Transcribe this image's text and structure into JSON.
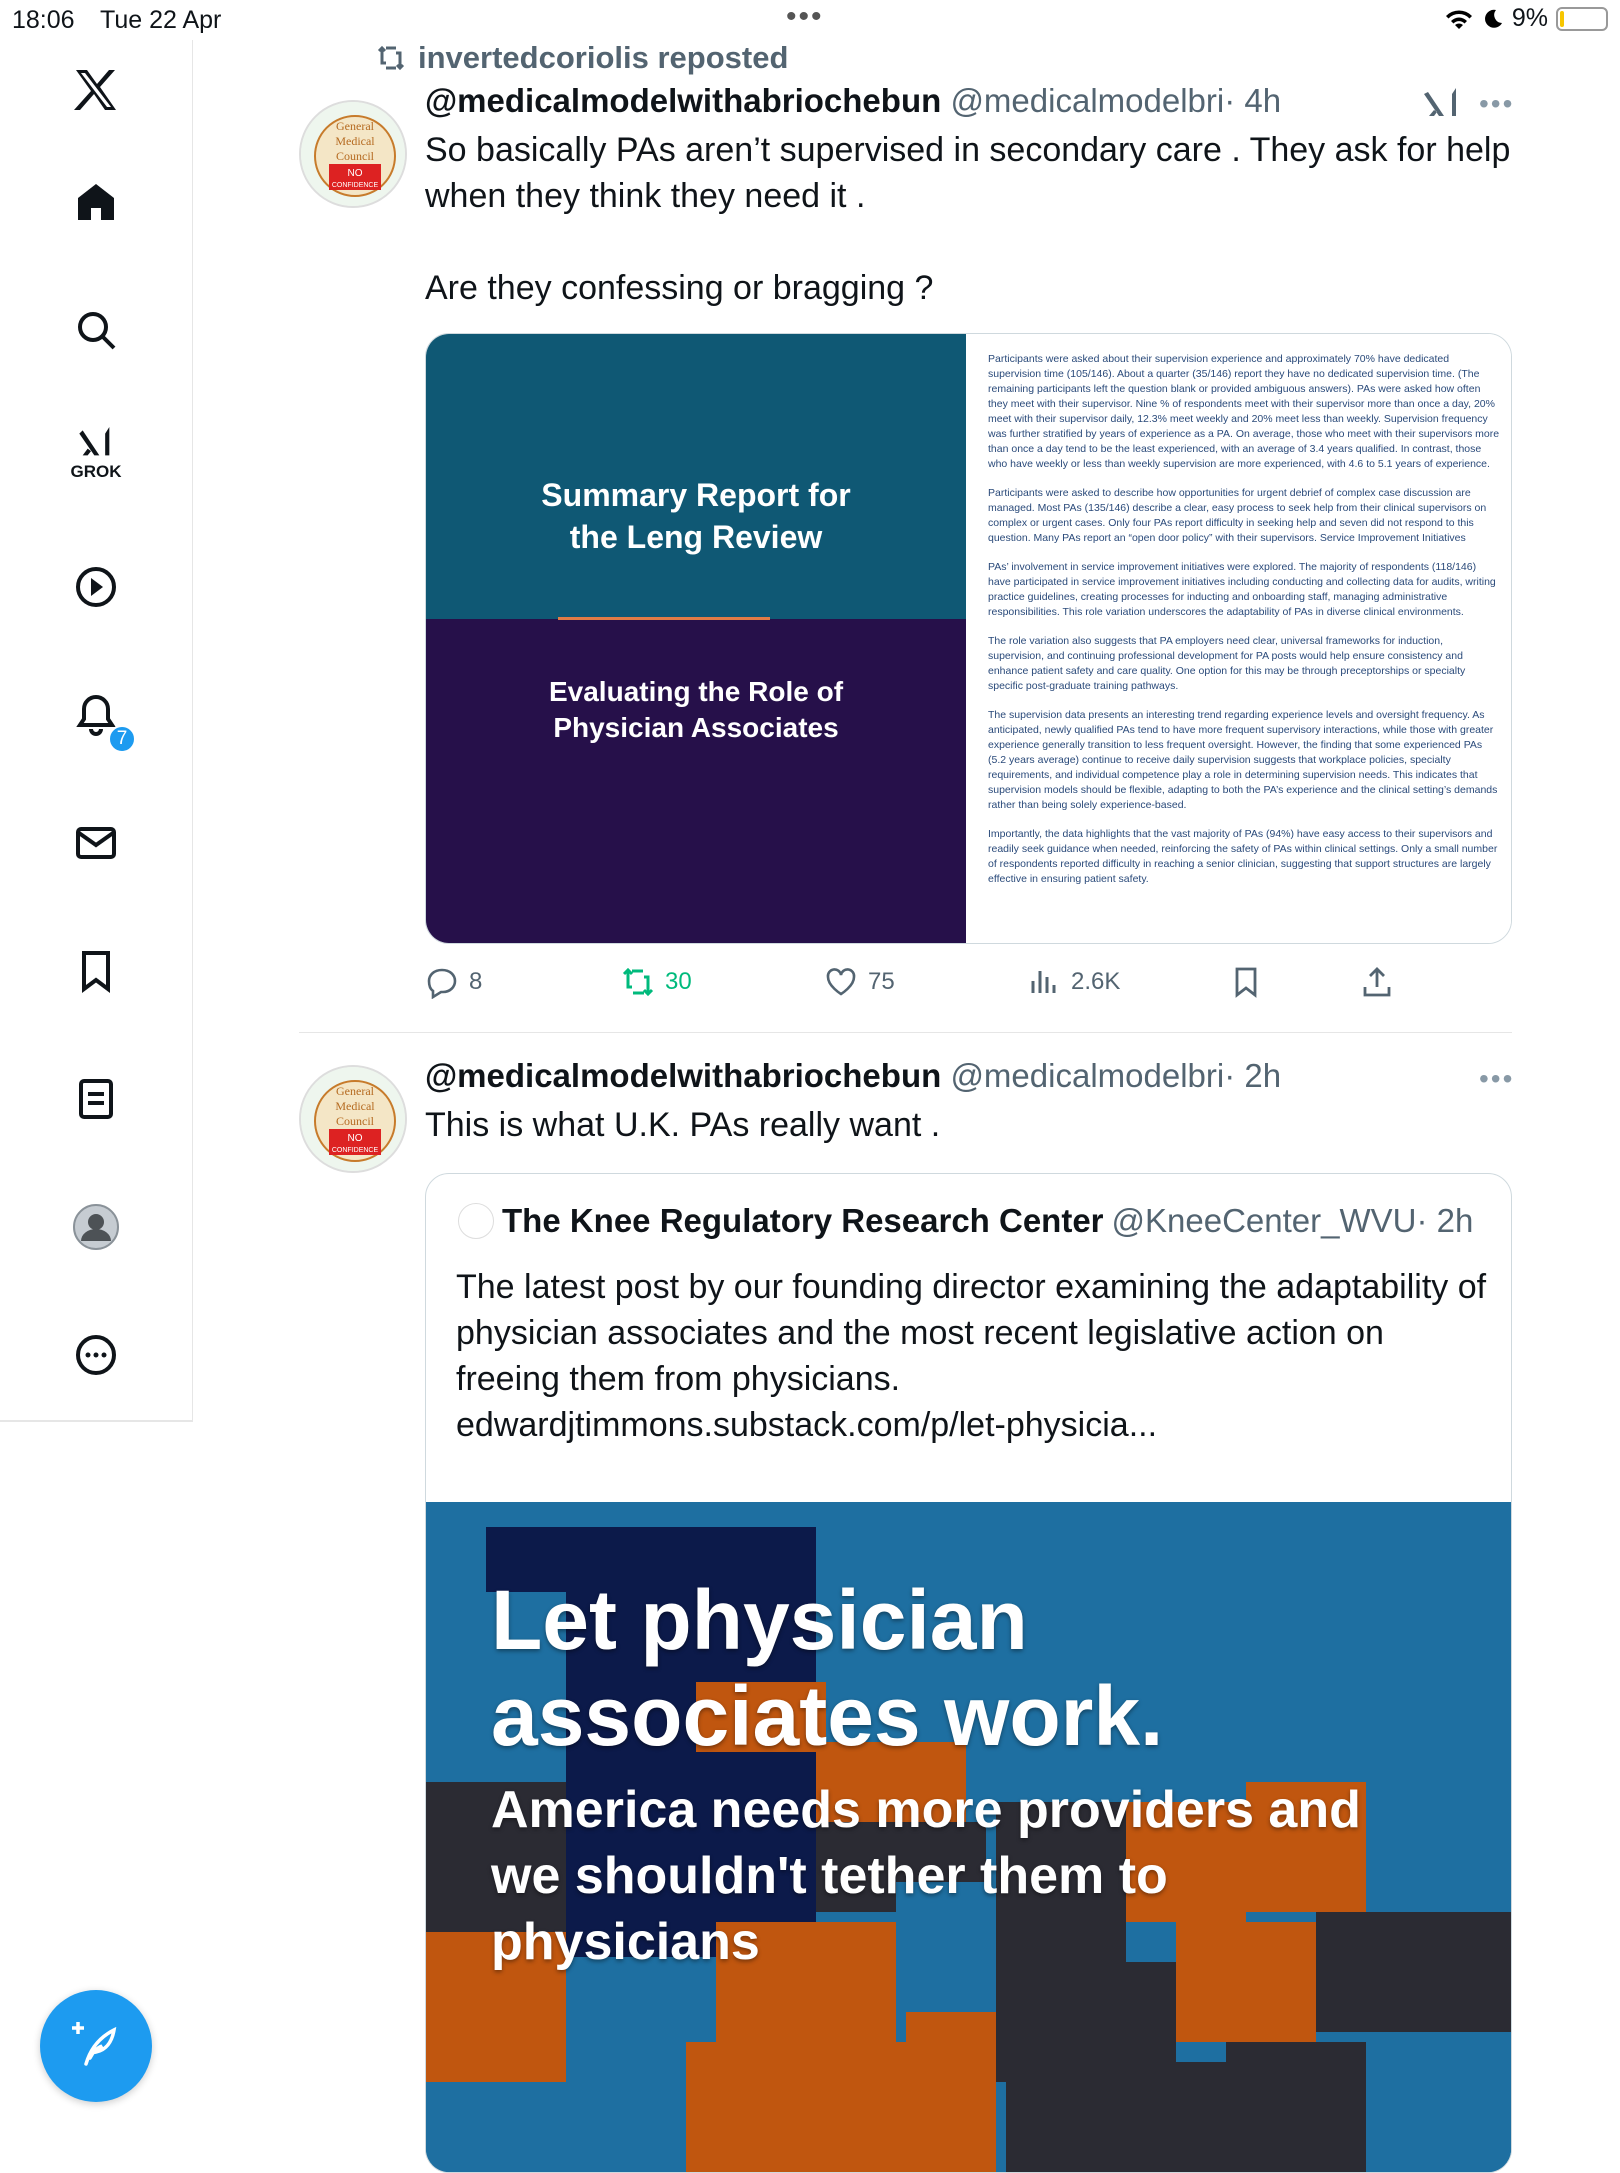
{
  "status_bar": {
    "time": "18:06",
    "date": "Tue 22 Apr",
    "more": "•••",
    "battery": "9%",
    "battery_level": 0.09
  },
  "sidebar": {
    "items": [
      "X home logo",
      "Home",
      "Search",
      "Grok",
      "Videos",
      "Notifications",
      "Messages",
      "Bookmarks",
      "Lists",
      "Profile",
      "More"
    ],
    "grok_label": "GROK",
    "notification_count": "7"
  },
  "post1": {
    "repost_label": "invertedcoriolis reposted",
    "name": "@medicalmodelwithabriochebun",
    "handle": "@medicalmodelbri",
    "time": "· 4h",
    "text": "So basically PAs aren’t supervised in secondary care . They ask for help when they think they need it .\n\nAre they confessing or bragging ?",
    "media": {
      "cover_title": "Summary Report for\nthe Leng Review",
      "cover_subtitle": "Evaluating the Role of\nPhysician Associates",
      "doc_paragraphs": [
        "Participants were asked about their supervision experience and approximately 70% have dedicated supervision time (105/146). About a quarter (35/146) report they have no dedicated supervision time. (The remaining participants left the question blank or provided ambiguous answers). PAs were asked how often they meet with their supervisor. Nine % of respondents meet with their supervisor more than once a day, 20% meet with their supervisor daily, 12.3% meet weekly and 20% meet less than weekly. Supervision frequency was further stratified by years of experience as a PA. On average, those who meet with their supervisors more than once a day tend to be the least experienced, with an average of 3.4 years qualified. In contrast, those who have weekly or less than weekly supervision are more experienced, with 4.6 to 5.1 years of experience.",
        "Participants were asked to describe how opportunities for urgent debrief of complex case discussion are managed. Most PAs (135/146) describe a clear, easy process to seek help from their clinical supervisors on complex or urgent cases. Only four PAs report difficulty in seeking help and seven did not respond to this question. Many PAs report an “open door policy” with their supervisors. Service Improvement Initiatives",
        "PAs’ involvement in service improvement initiatives were explored. The majority of respondents (118/146) have participated in service improvement initiatives including conducting and collecting data for audits, writing practice guidelines, creating processes for inducting and onboarding staff, managing administrative responsibilities. This role variation underscores the adaptability of PAs in diverse clinical environments.",
        "The role variation also suggests that PA employers need clear, universal frameworks for induction, supervision, and continuing professional development for PA posts would help ensure consistency and enhance patient safety and care quality. One option for this may be through preceptorships or specialty specific post-graduate training pathways.",
        "The supervision data presents an interesting trend regarding experience levels and oversight frequency. As anticipated, newly qualified PAs tend to have more frequent supervisory interactions, while those with greater experience generally transition to less frequent oversight. However, the finding that some experienced PAs (5.2 years average) continue to receive daily supervision suggests that workplace policies, specialty requirements, and individual competence play a role in determining supervision needs. This indicates that supervision models should be flexible, adapting to both the PA’s experience and the clinical setting’s demands rather than being solely experience-based.",
        "Importantly, the data highlights that the vast majority of PAs (94%) have easy access to their supervisors and readily seek guidance when needed, reinforcing the safety of PAs within clinical settings. Only a small number of respondents reported difficulty in reaching a senior clinician, suggesting that support structures are largely effective in ensuring patient safety."
      ]
    },
    "actions": {
      "replies": "8",
      "reposts": "30",
      "likes": "75",
      "views": "2.6K"
    }
  },
  "post2": {
    "name": "@medicalmodelwithabriochebun",
    "handle": "@medicalmodelbri",
    "time": "· 2h",
    "text": "This is what U.K. PAs really want .",
    "quote": {
      "name": "The Knee Regulatory Research Center",
      "handle": "@KneeCenter_WVU",
      "time": "· 2h",
      "text": "The latest post by our founding director examining the adaptability of physician associates and the most recent legislative action on freeing them from physicians.\nedwardjtimmons.substack.com/p/let-physicia...",
      "image_headline": "Let physician\nassociates work.",
      "image_sub": "America needs more providers and\nwe shouldn't tether them to\nphysicians"
    }
  },
  "avatar_text": [
    "General",
    "Medical",
    "Council",
    "NO",
    "CONFIDENCE"
  ],
  "colors": {
    "accent": "#1d9bf0",
    "repost_green": "#00ba7c",
    "cover_teal": "#0f5874",
    "cover_purple": "#26104a",
    "map_blue": "#1e6fa1",
    "map_orange": "#c0560f",
    "map_dark": "#2b2b33",
    "map_navy": "#0c1a4a"
  }
}
